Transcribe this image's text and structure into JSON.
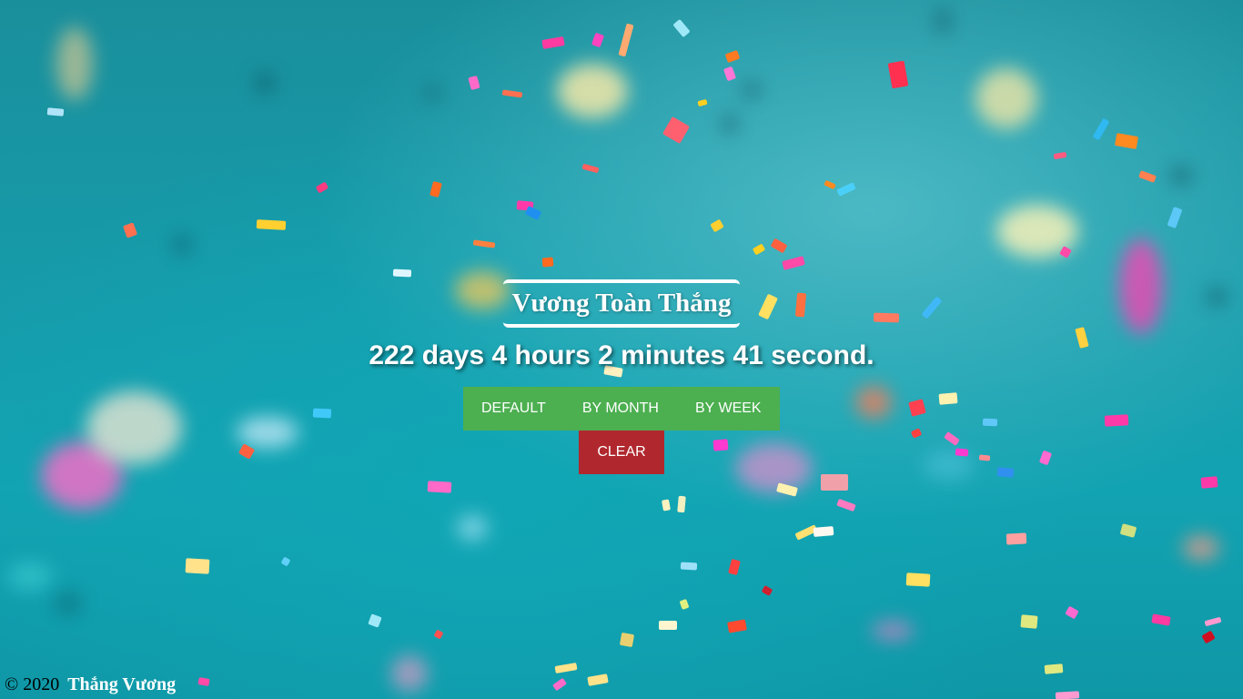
{
  "page": {
    "title": "Vương Toàn Thắng",
    "countdown": "222 days 4 hours 2 minutes 41 second."
  },
  "buttons": {
    "default": "DEFAULT",
    "by_month": "BY MONTH",
    "by_week": "BY WEEK",
    "clear": "CLEAR"
  },
  "footer": {
    "copyright": "© 2020",
    "author": "Thắng Vương"
  },
  "colors": {
    "button_green": "#4caf50",
    "button_red": "#b0282e",
    "background_teal": "#169cab"
  }
}
